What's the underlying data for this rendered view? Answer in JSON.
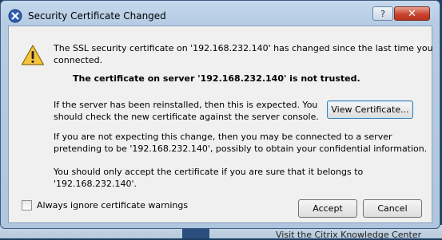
{
  "window": {
    "title": "Security Certificate Changed",
    "help_label": "?",
    "close_label": "✕"
  },
  "dialog": {
    "message_line1": "The SSL security certificate on '192.168.232.140' has changed since the last time you",
    "message_line2": "connected.",
    "not_trusted": "The certificate on server '192.168.232.140' is not trusted.",
    "reinstalled_line1": "If the server has been reinstalled, then this is expected.  You",
    "reinstalled_line2": "should check the new certificate against the server console.",
    "not_expecting_line1": "If you are not expecting this change, then you may be connected to a server",
    "not_expecting_line2": "pretending to be '192.168.232.140', possibly to obtain your confidential information.",
    "accept_only_line1": "You should only accept the certificate if you are sure that it belongs to",
    "accept_only_line2": "'192.168.232.140'.",
    "view_certificate_label": "View Certificate...",
    "ignore_warnings_label": "Always ignore certificate warnings",
    "ignore_warnings_checked": false,
    "accept_label": "Accept",
    "cancel_label": "Cancel"
  },
  "background": {
    "partial_text": "Visit the Citrix Knowledge Center"
  }
}
